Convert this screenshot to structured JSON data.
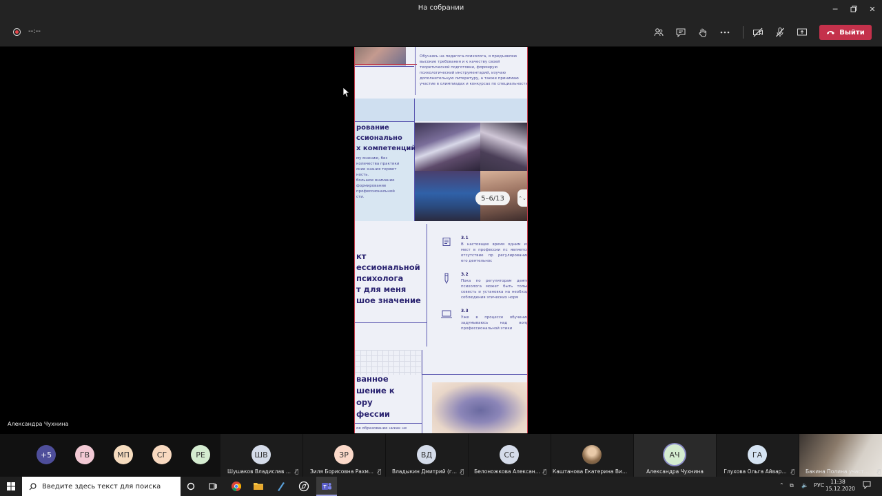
{
  "window": {
    "title": "На собрании"
  },
  "toolbar": {
    "timer": "--:--",
    "leave_label": "Выйти"
  },
  "slide": {
    "para1": "Обучаясь на педагога-психолога, я предъявляю высокие требования и к качеству своей теоретической подготовки, формирую психологический инструментарий, изучаю дополнительную литературу, а также принимаю участие в олимпиадах и конкурсах по специальности",
    "head2": [
      "рование",
      "ссионально",
      "х компетенций"
    ],
    "para2": [
      "му мнению, без",
      "количества практики",
      "ские знания теряют",
      "ность.",
      "большое внимание",
      "формирование",
      "профессиональной",
      "сти."
    ],
    "head3": [
      "кт",
      "ессиональной",
      "психолога",
      "т для меня",
      "шое значение"
    ],
    "items": [
      {
        "num": "3.1",
        "text": "В настоящее время одним из мест в профессии пс является отсутствие пр регулирования его деятельнос"
      },
      {
        "num": "3.2",
        "text": "Пока по регуляторам деяте психолога может быть тольк совесть и установка на необход соблюдения этических норм"
      },
      {
        "num": "3.3",
        "text": "Уже в процессе обучения задумываюсь над вопр профессиональной этики"
      }
    ],
    "head4": [
      "ванное",
      "шение к",
      "ору",
      "фессии"
    ],
    "footer_text": "ое образование никак не"
  },
  "slide_counter": "5–6/13",
  "presenter_name": "Александра Чухнина",
  "roster": {
    "overflow": "+5",
    "small": [
      {
        "initials": "ГВ",
        "color": "#f2c9d4"
      },
      {
        "initials": "МП",
        "color": "#f6dcbf"
      },
      {
        "initials": "СГ",
        "color": "#f8d9c0"
      },
      {
        "initials": "РЕ",
        "color": "#d4ecd0"
      }
    ],
    "tiles": [
      {
        "initials": "ШВ",
        "name": "Шушаков Владислав ...",
        "color": "#d5dcea"
      },
      {
        "initials": "ЗР",
        "name": "Зиля Борисовна Рахм...",
        "color": "#fbd9c9"
      },
      {
        "initials": "ВД",
        "name": "Владыкин Дмитрий (г...",
        "color": "#d5dcea"
      },
      {
        "initials": "СС",
        "name": "Белоножкова Алексан...",
        "color": "#d5dcea"
      },
      {
        "initials": "",
        "name": "Каштанова Екатерина Ви...",
        "color": "#c9a173"
      },
      {
        "initials": "АЧ",
        "name": "Александра Чухнина",
        "color": "#d4ecd0"
      },
      {
        "initials": "ГА",
        "name": "Глухова Ольга Айвар...",
        "color": "#d5e3f2"
      },
      {
        "initials": "",
        "name": "Бакина Полина участ...",
        "color": "#8a7a6a"
      }
    ]
  },
  "taskbar": {
    "search_placeholder": "Введите здесь текст для поиска",
    "lang": "РУС",
    "time": "11:38",
    "date": "15.12.2020"
  }
}
